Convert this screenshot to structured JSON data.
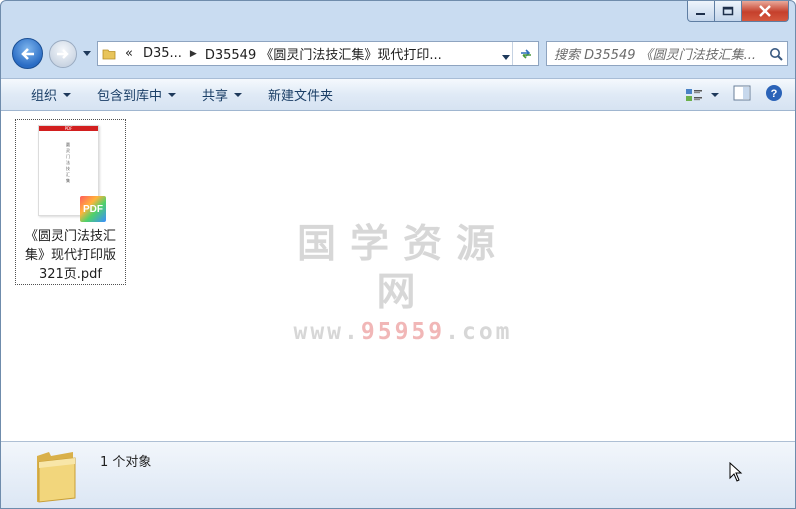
{
  "window": {
    "caption": {
      "minimize": "minimize",
      "maximize": "maximize",
      "close": "close"
    }
  },
  "address": {
    "overflow": "«",
    "crumbs": [
      "D35...",
      "D35549 《圆灵门法技汇集》现代打印..."
    ]
  },
  "search": {
    "placeholder": "搜索 D35549 《圆灵门法技汇集..."
  },
  "toolbar": {
    "organize": "组织",
    "include_library": "包含到库中",
    "share": "共享",
    "new_folder": "新建文件夹"
  },
  "file": {
    "thumb_header": "PDF",
    "thumb_title": "圆灵门法技汇集",
    "badge": "PDF",
    "name_line1": "《圆灵门法技汇",
    "name_line2": "集》现代打印版",
    "name_line3": "321页.pdf"
  },
  "watermark": {
    "cn": "国学资源网",
    "url_prefix": "www.",
    "url_digits": "95959",
    "url_suffix": ".com"
  },
  "details": {
    "count": "1 个对象"
  },
  "colors": {
    "accent": "#2a6cc4",
    "close": "#c5402c",
    "watermark": "#d7d7d7"
  }
}
